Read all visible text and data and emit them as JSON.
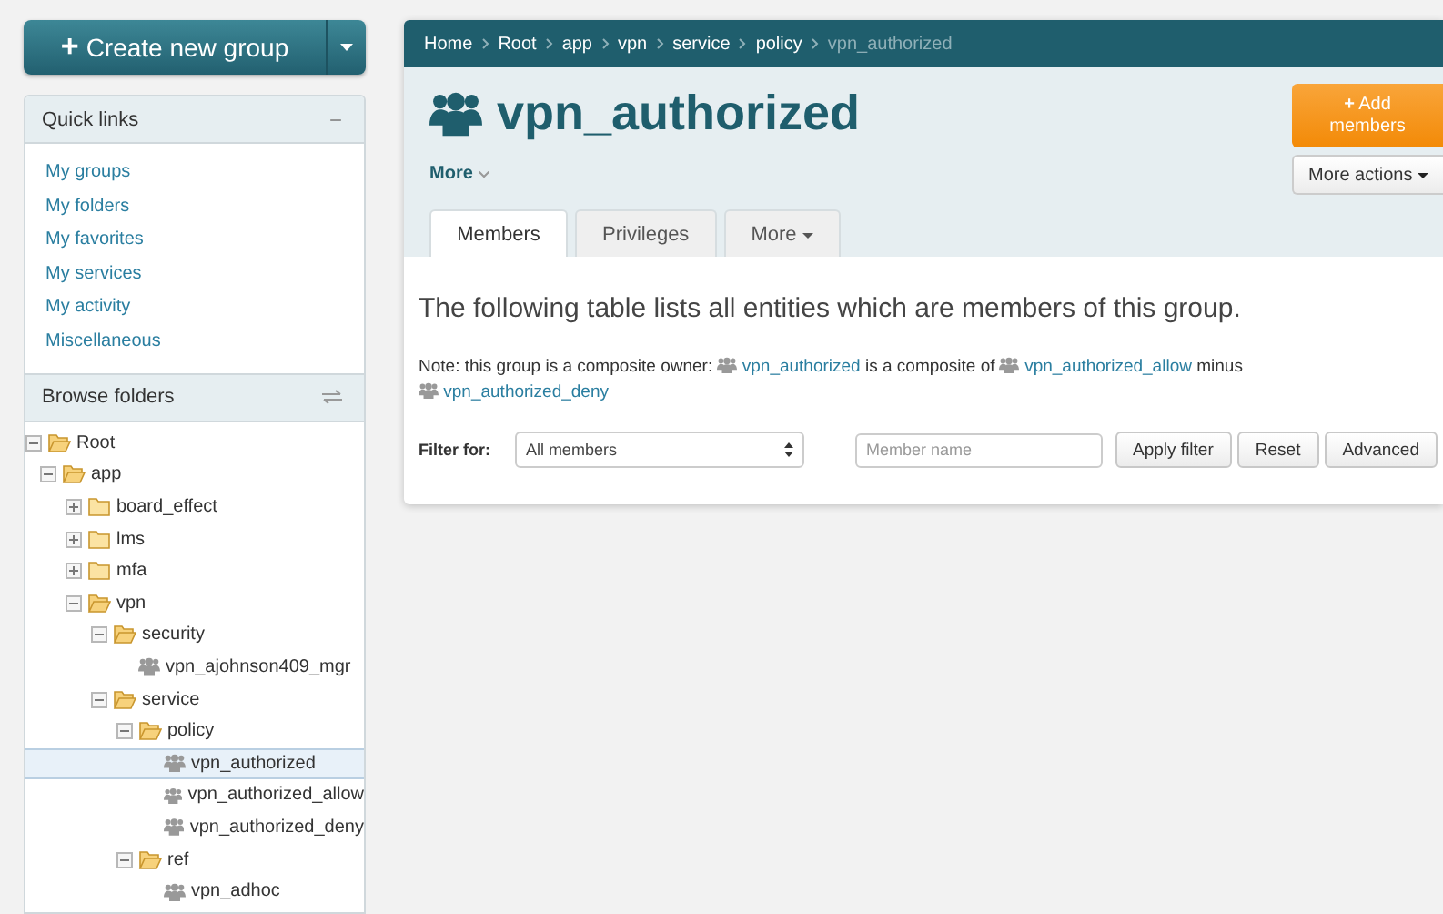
{
  "create_button": {
    "label": "Create new group",
    "icon": "+"
  },
  "quick_links": {
    "title": "Quick links",
    "toggle": "−",
    "items": [
      "My groups",
      "My folders",
      "My favorites",
      "My services",
      "My activity",
      "Miscellaneous"
    ]
  },
  "browse": {
    "title": "Browse folders",
    "tree": [
      {
        "label": "Root",
        "kind": "folder",
        "expanded": true,
        "selected": false,
        "children": [
          {
            "label": "app",
            "kind": "folder",
            "expanded": true,
            "selected": false,
            "children": [
              {
                "label": "board_effect",
                "kind": "folder",
                "expanded": false,
                "selected": false
              },
              {
                "label": "lms",
                "kind": "folder",
                "expanded": false,
                "selected": false
              },
              {
                "label": "mfa",
                "kind": "folder",
                "expanded": false,
                "selected": false
              },
              {
                "label": "vpn",
                "kind": "folder",
                "expanded": true,
                "selected": false,
                "children": [
                  {
                    "label": "security",
                    "kind": "folder",
                    "expanded": true,
                    "selected": false,
                    "children": [
                      {
                        "label": "vpn_ajohnson409_mgr",
                        "kind": "group",
                        "selected": false
                      }
                    ]
                  },
                  {
                    "label": "service",
                    "kind": "folder",
                    "expanded": true,
                    "selected": false,
                    "children": [
                      {
                        "label": "policy",
                        "kind": "folder",
                        "expanded": true,
                        "selected": false,
                        "children": [
                          {
                            "label": "vpn_authorized",
                            "kind": "group",
                            "selected": true
                          },
                          {
                            "label": "vpn_authorized_allow",
                            "kind": "group",
                            "selected": false
                          },
                          {
                            "label": "vpn_authorized_deny",
                            "kind": "group",
                            "selected": false
                          }
                        ]
                      },
                      {
                        "label": "ref",
                        "kind": "folder",
                        "expanded": true,
                        "selected": false,
                        "children": [
                          {
                            "label": "vpn_adhoc",
                            "kind": "group",
                            "selected": false
                          }
                        ]
                      }
                    ]
                  }
                ]
              }
            ]
          }
        ]
      }
    ]
  },
  "breadcrumb": [
    "Home",
    "Root",
    "app",
    "vpn",
    "service",
    "policy",
    "vpn_authorized"
  ],
  "title": "vpn_authorized",
  "more_link": "More",
  "add_button": {
    "icon": "+",
    "label": "Add members"
  },
  "more_actions": "More actions",
  "tabs": [
    {
      "label": "Members",
      "selected": true,
      "dropdown": false
    },
    {
      "label": "Privileges",
      "selected": false,
      "dropdown": false
    },
    {
      "label": "More",
      "selected": false,
      "dropdown": true
    }
  ],
  "intro": "The following table lists all entities which are members of this group.",
  "note": [
    {
      "kind": "text",
      "text": "Note: this group is a composite owner:"
    },
    {
      "kind": "group-link",
      "text": "vpn_authorized"
    },
    {
      "kind": "text",
      "text": "is a composite of"
    },
    {
      "kind": "group-link",
      "text": "vpn_authorized_allow"
    },
    {
      "kind": "text",
      "text": "minus"
    },
    {
      "kind": "group-link",
      "text": "vpn_authorized_deny"
    }
  ],
  "filter": {
    "label": "Filter for:",
    "select": "All members",
    "placeholder": "Member name",
    "buttons": [
      "Apply filter",
      "Reset",
      "Advanced"
    ]
  }
}
